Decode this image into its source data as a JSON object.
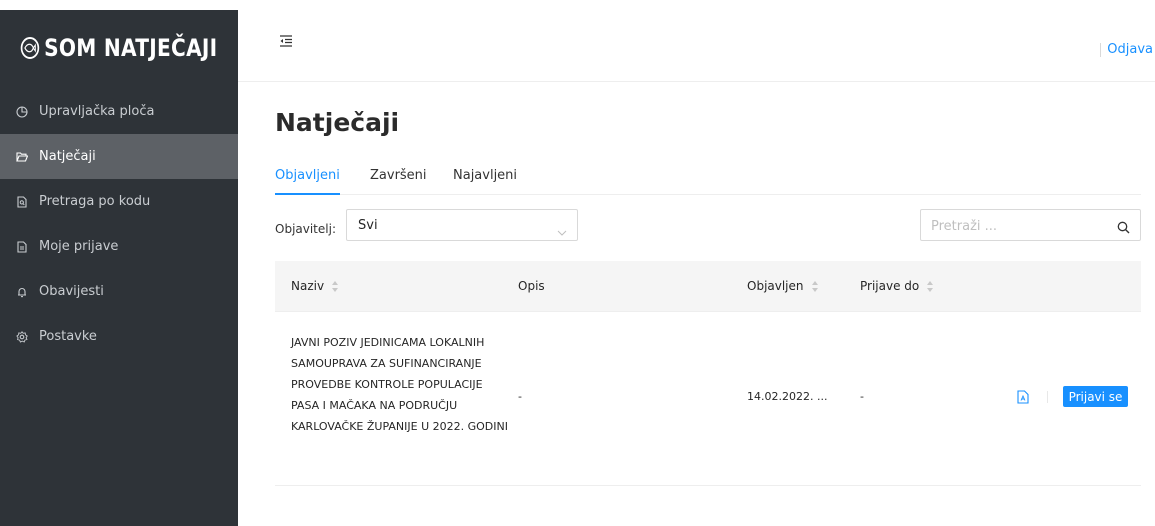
{
  "brand": {
    "name": "SOM NATJEČAJI"
  },
  "sidebar": {
    "items": [
      {
        "label": "Upravljačka ploča",
        "icon": "pie-chart-icon",
        "active": false
      },
      {
        "label": "Natječaji",
        "icon": "folder-open-icon",
        "active": true
      },
      {
        "label": "Pretraga po kodu",
        "icon": "file-search-icon",
        "active": false
      },
      {
        "label": "Moje prijave",
        "icon": "file-text-icon",
        "active": false
      },
      {
        "label": "Obavijesti",
        "icon": "bell-icon",
        "active": false
      },
      {
        "label": "Postavke",
        "icon": "gear-icon",
        "active": false
      }
    ]
  },
  "header": {
    "toggle_icon": "menu-fold-icon",
    "logout_label": "Odjava"
  },
  "main": {
    "title": "Natječaji",
    "tabs": [
      {
        "label": "Objavljeni",
        "active": true
      },
      {
        "label": "Završeni",
        "active": false
      },
      {
        "label": "Najavljeni",
        "active": false
      }
    ],
    "filter": {
      "label": "Objavitelj:",
      "value": "Svi"
    },
    "search": {
      "placeholder": "Pretraži ..."
    }
  },
  "table": {
    "columns": [
      {
        "label": "Naziv",
        "sortable": true
      },
      {
        "label": "Opis",
        "sortable": false
      },
      {
        "label": "Objavljen",
        "sortable": true
      },
      {
        "label": "Prijave do",
        "sortable": true
      }
    ],
    "rows": [
      {
        "title": "JAVNI POZIV JEDINICAMA LOKALNIH SAMOUPRAVA ZA SUFINANCIRANJE PROVEDBE KONTROLE POPULACIJE PASA I MAČAKA NA PODRUČJU KARLOVAČKE ŽUPANIJE U 2022. GODINI",
        "description": "-",
        "published": "14.02.2022. ...",
        "deadline": "-",
        "apply_label": "Prijavi se"
      }
    ]
  },
  "colors": {
    "sidebar_bg": "#2e3338",
    "active_item_bg": "#5d6166",
    "accent": "#1890ff"
  }
}
